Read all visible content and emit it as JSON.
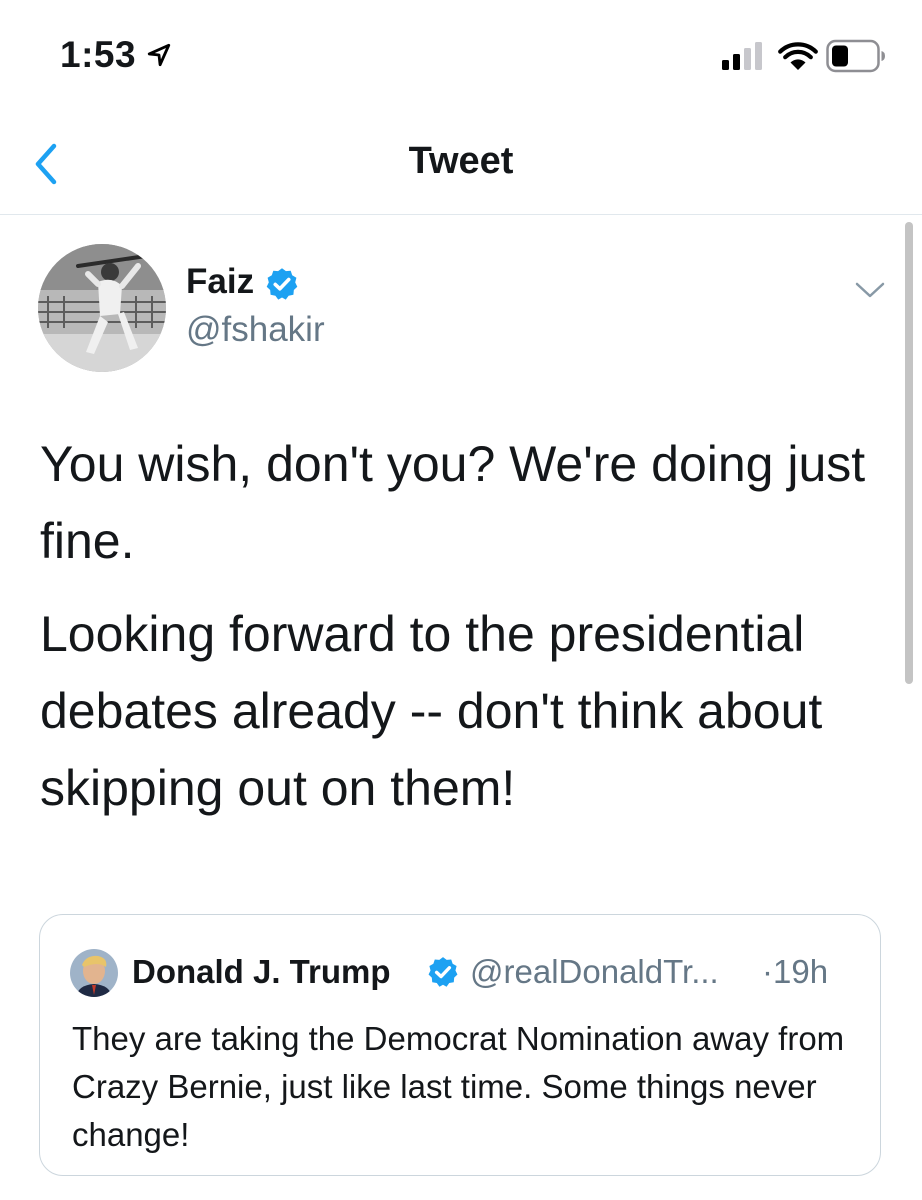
{
  "status_bar": {
    "time": "1:53"
  },
  "nav": {
    "title": "Tweet"
  },
  "tweet": {
    "author_name": "Faiz",
    "author_handle": "@fshakir",
    "paragraphs": [
      "You wish, don't you? We're doing just fine.",
      "Looking forward to the presidential debates already -- don't think about skipping out on them!"
    ]
  },
  "quoted_tweet": {
    "author_name": "Donald J. Trump",
    "author_handle": "@realDonaldTr...",
    "time": "·19h",
    "text": "They are taking the Democrat Nomination away from Crazy Bernie, just like last time. Some things never change!"
  },
  "colors": {
    "accent": "#1da1f2",
    "text": "#14171a",
    "secondary": "#657786",
    "border": "#ccd6dd"
  },
  "icons": [
    "location-arrow-icon",
    "cellular-signal-icon",
    "wifi-icon",
    "battery-icon",
    "back-chevron-icon",
    "verified-badge-icon",
    "chevron-down-icon"
  ]
}
